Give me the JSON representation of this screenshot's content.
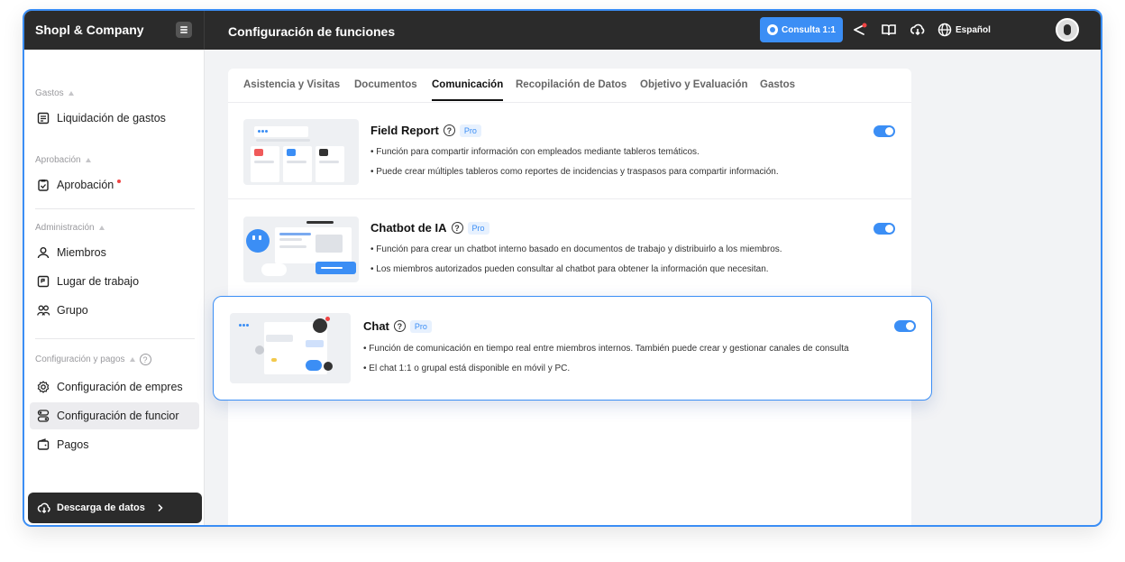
{
  "app": {
    "brand": "Shopl & Company",
    "page_title": "Configuración de funciones",
    "consult_label": "Consulta 1:1",
    "language": "Español"
  },
  "sidebar": {
    "sections": [
      {
        "label": "Gastos",
        "items": [
          {
            "label": "Liquidación de gastos",
            "icon": "receipt-icon"
          }
        ]
      },
      {
        "label": "Aprobación",
        "items": [
          {
            "label": "Aprobación",
            "icon": "clipboard-check-icon",
            "has_notification": true
          }
        ]
      },
      {
        "label": "Administración",
        "items": [
          {
            "label": "Miembros",
            "icon": "user-icon"
          },
          {
            "label": "Lugar de trabajo",
            "icon": "building-icon"
          },
          {
            "label": "Grupo",
            "icon": "users-icon"
          }
        ]
      },
      {
        "label": "Configuración y pagos",
        "items": [
          {
            "label": "Configuración de empres",
            "icon": "gear-icon"
          },
          {
            "label": "Configuración de funcior",
            "icon": "toggles-icon",
            "active": true
          },
          {
            "label": "Pagos",
            "icon": "wallet-icon"
          }
        ]
      }
    ],
    "download_label": "Descarga de datos"
  },
  "tabs": [
    {
      "label": "Asistencia y Visitas"
    },
    {
      "label": "Documentos"
    },
    {
      "label": "Comunicación",
      "active": true
    },
    {
      "label": "Recopilación de Datos"
    },
    {
      "label": "Objetivo y Evaluación"
    },
    {
      "label": "Gastos"
    }
  ],
  "features": [
    {
      "title": "Field Report",
      "badge": "Pro",
      "enabled": true,
      "lines": [
        "Función para compartir información con empleados mediante tableros temáticos.",
        "Puede crear múltiples tableros como reportes de incidencias y traspasos para compartir información."
      ]
    },
    {
      "title": "Chatbot de IA",
      "badge": "Pro",
      "enabled": true,
      "lines": [
        "Función para crear un chatbot interno basado en documentos de trabajo y distribuirlo a los miembros.",
        "Los miembros autorizados pueden consultar al chatbot para obtener la información que necesitan."
      ]
    },
    {
      "title": "Chat",
      "badge": "Pro",
      "enabled": true,
      "lines": [
        "Función de comunicación en tiempo real entre miembros internos. También puede crear y gestionar canales de consulta",
        "El chat 1:1 o grupal está disponible en móvil y PC."
      ]
    }
  ],
  "colors": {
    "accent": "#3b8ef5",
    "topbar": "#2b2b2b",
    "notification": "#f04444"
  }
}
